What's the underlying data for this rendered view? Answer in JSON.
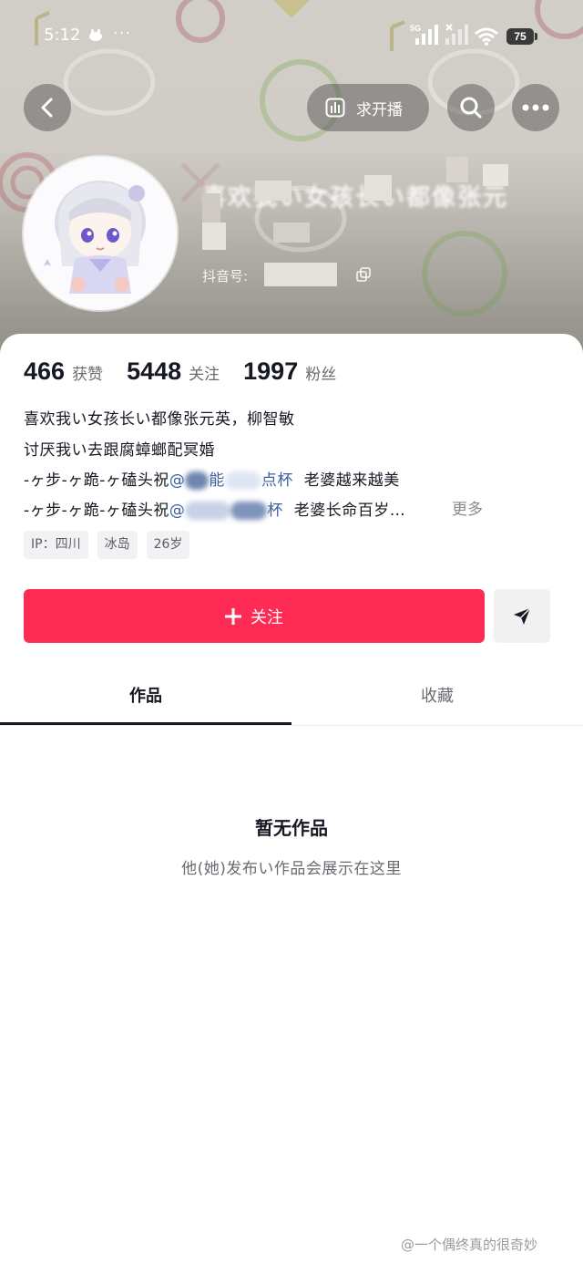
{
  "status_bar": {
    "time": "5:12",
    "more": "···",
    "network": "5G",
    "battery": "75"
  },
  "nav": {
    "live_label": "求开播"
  },
  "profile": {
    "name": "喜欢我い女孩长い都像张元",
    "douyin_id_label": "抖音号:",
    "stats": [
      {
        "value": "466",
        "label": "获赞"
      },
      {
        "value": "5448",
        "label": "关注"
      },
      {
        "value": "1997",
        "label": "粉丝"
      }
    ],
    "bio": {
      "line1": "喜欢我い女孩长い都像张元英，柳智敏",
      "line2": "讨厌我い去跟腐蟑螂配冥婚",
      "line3_prefix": "-ヶ步-ヶ跪-ヶ磕头祝",
      "line3_mention_a": "@",
      "line3_mention_b": "能",
      "line3_mention_c": "点杯",
      "line3_suffix": "老婆越来越美",
      "line4_prefix": "-ヶ步-ヶ跪-ヶ磕头祝",
      "line4_mention_a": "@",
      "line4_mention_b": "杯",
      "line4_suffix": "老婆长命百岁…",
      "more": "更多"
    },
    "tags": [
      "IP：四川",
      "冰岛",
      "26岁"
    ]
  },
  "actions": {
    "follow_label": "关注"
  },
  "tabs": [
    {
      "label": "作品"
    },
    {
      "label": "收藏"
    }
  ],
  "empty": {
    "title": "暂无作品",
    "subtitle": "他(她)发布い作品会展示在这里"
  },
  "watermark": "@一个偶终真的很奇妙",
  "colors": {
    "accent": "#fe2c55",
    "mention": "#3a5f9c"
  }
}
